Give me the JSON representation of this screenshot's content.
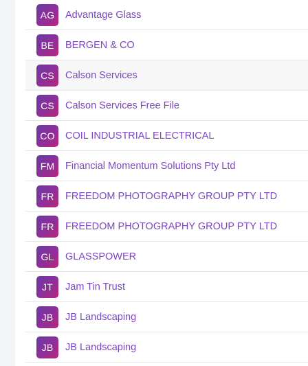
{
  "colors": {
    "link": "#7b47c0",
    "avatar_gradient_start": "#6a3aa4",
    "avatar_gradient_end": "#b8277a",
    "divider": "#e6e7ea",
    "hover_row": "#f7f7f8"
  },
  "contacts": [
    {
      "initials": "AG",
      "name": "Advantage Glass"
    },
    {
      "initials": "BE",
      "name": "BERGEN & CO"
    },
    {
      "initials": "CS",
      "name": "Calson Services"
    },
    {
      "initials": "CS",
      "name": "Calson Services Free File"
    },
    {
      "initials": "CO",
      "name": "COIL INDUSTRIAL ELECTRICAL"
    },
    {
      "initials": "FM",
      "name": "Financial Momentum Solutions Pty Ltd"
    },
    {
      "initials": "FR",
      "name": "FREEDOM PHOTOGRAPHY GROUP PTY LTD"
    },
    {
      "initials": "FR",
      "name": "FREEDOM PHOTOGRAPHY GROUP PTY LTD"
    },
    {
      "initials": "GL",
      "name": "GLASSPOWER"
    },
    {
      "initials": "JT",
      "name": "Jam Tin Trust"
    },
    {
      "initials": "JB",
      "name": "JB Landscaping"
    },
    {
      "initials": "JB",
      "name": "JB Landscaping"
    }
  ]
}
